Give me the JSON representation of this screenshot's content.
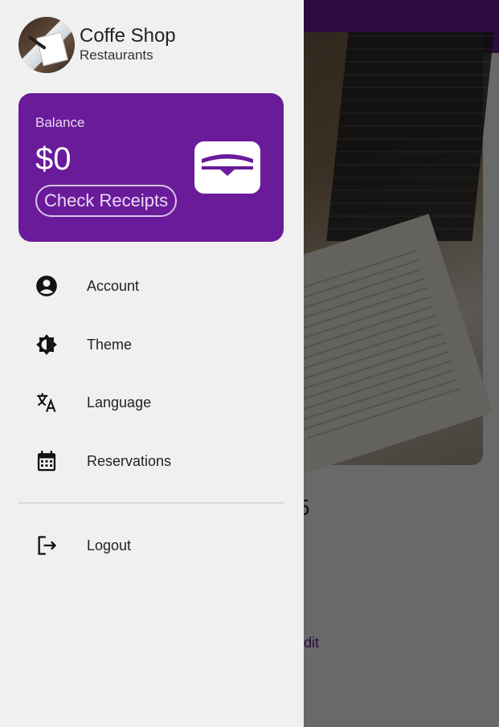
{
  "drawer": {
    "title": "Coffe Shop",
    "subtitle": "Restaurants",
    "balance": {
      "label": "Balance",
      "value": "$0",
      "button_label": "Check Receipts",
      "icon": "wallet-icon"
    },
    "items": [
      {
        "label": "Account",
        "icon": "account-circle-icon"
      },
      {
        "label": "Theme",
        "icon": "brightness-icon"
      },
      {
        "label": "Language",
        "icon": "translate-icon"
      },
      {
        "label": "Reservations",
        "icon": "calendar-icon"
      }
    ],
    "logout": {
      "label": "Logout",
      "icon": "logout-icon"
    }
  },
  "background": {
    "partial_text": "5",
    "partial_link": "dit"
  },
  "colors": {
    "accent": "#6a1b9a",
    "drawer_bg": "#f0f0f0"
  }
}
